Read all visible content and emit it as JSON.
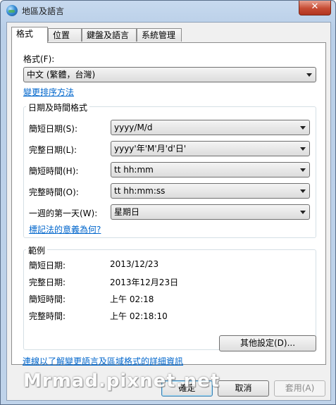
{
  "window": {
    "title": "地區及語言",
    "close_symbol": "✕"
  },
  "tabs": [
    {
      "label": "格式"
    },
    {
      "label": "位置"
    },
    {
      "label": "鍵盤及語言"
    },
    {
      "label": "系統管理"
    }
  ],
  "format": {
    "label": "格式(F):",
    "value": "中文 (繁體，台灣)",
    "change_sort_link": "變更排序方法"
  },
  "datetime": {
    "group_title": "日期及時間格式",
    "rows": [
      {
        "label": "簡短日期(S):",
        "value": "yyyy/M/d"
      },
      {
        "label": "完整日期(L):",
        "value": "yyyy'年'M'月'd'日'"
      },
      {
        "label": "簡短時間(H):",
        "value": "tt hh:mm"
      },
      {
        "label": "完整時間(O):",
        "value": "tt hh:mm:ss"
      },
      {
        "label": "一週的第一天(W):",
        "value": "星期日"
      }
    ],
    "notation_link": "標記法的意義為何?"
  },
  "examples": {
    "group_title": "範例",
    "rows": [
      {
        "label": "簡短日期:",
        "value": "2013/12/23"
      },
      {
        "label": "完整日期:",
        "value": "2013年12月23日"
      },
      {
        "label": "簡短時間:",
        "value": "上午 02:18"
      },
      {
        "label": "完整時間:",
        "value": "上午 02:18:10"
      }
    ]
  },
  "buttons": {
    "additional_settings": "其他設定(D)...",
    "ok": "確定",
    "cancel": "取消",
    "apply": "套用(A)"
  },
  "online_link": "連線以了解變更語言及區域格式的詳細資訊",
  "watermark": "Mrmad.pixnet.net"
}
